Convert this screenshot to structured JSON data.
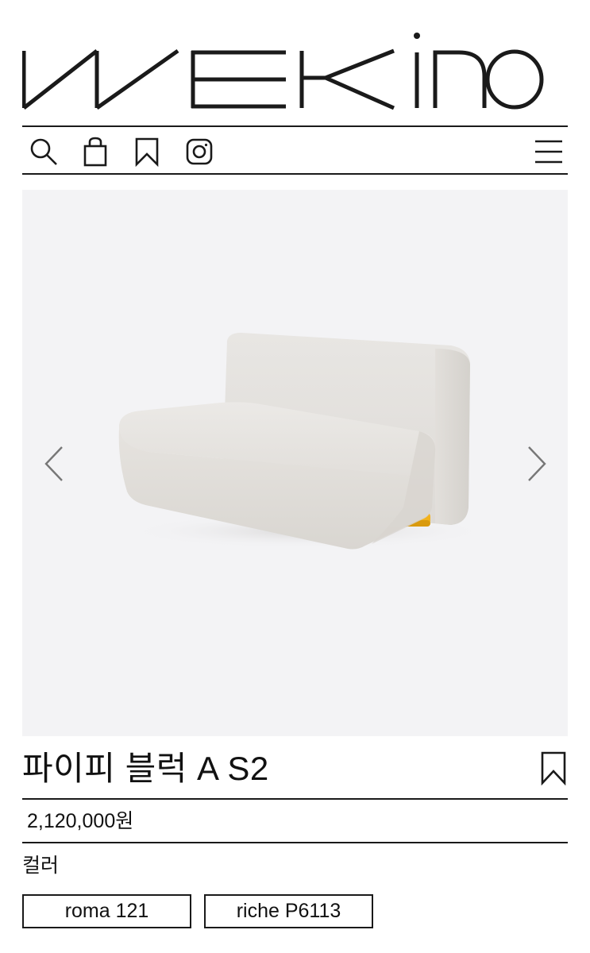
{
  "brand": {
    "name": "WEKINO"
  },
  "nav": {
    "icons": [
      "search-icon",
      "shopping-bag-icon",
      "bookmark-icon",
      "instagram-icon",
      "hamburger-menu-icon"
    ]
  },
  "gallery": {
    "prev_icon": "chevron-left-icon",
    "next_icon": "chevron-right-icon",
    "background": "#f3f3f5",
    "sofa_fabric": "#e6e3df",
    "sofa_leg": "#f2b21c"
  },
  "product": {
    "title": "파이피 블럭 A S2",
    "price": "2,120,000원",
    "color_label": "컬러",
    "options": [
      "roma 121",
      "riche P6113"
    ]
  }
}
